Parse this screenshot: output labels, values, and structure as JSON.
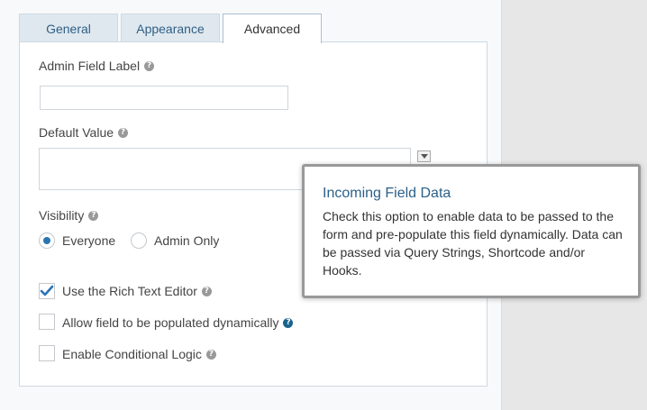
{
  "tabs": [
    {
      "label": "General",
      "active": false
    },
    {
      "label": "Appearance",
      "active": false
    },
    {
      "label": "Advanced",
      "active": true
    }
  ],
  "fields": {
    "admin_label": {
      "label": "Admin Field Label",
      "value": ""
    },
    "default_value": {
      "label": "Default Value",
      "value": ""
    },
    "visibility": {
      "label": "Visibility",
      "options": [
        {
          "label": "Everyone",
          "checked": true
        },
        {
          "label": "Admin Only",
          "checked": false
        }
      ]
    },
    "checkboxes": [
      {
        "label": "Use the Rich Text Editor",
        "checked": true
      },
      {
        "label": "Allow field to be populated dynamically",
        "checked": false
      },
      {
        "label": "Enable Conditional Logic",
        "checked": false
      }
    ]
  },
  "tooltip": {
    "title": "Incoming Field Data",
    "body": "Check this option to enable data to be passed to the form and pre-populate this field dynamically. Data can be passed via Query Strings, Shortcode and/or Hooks."
  },
  "colors": {
    "accent": "#2a74b5",
    "tab_inactive_bg": "#dfe8ef",
    "tooltip_title": "#2c6089"
  }
}
